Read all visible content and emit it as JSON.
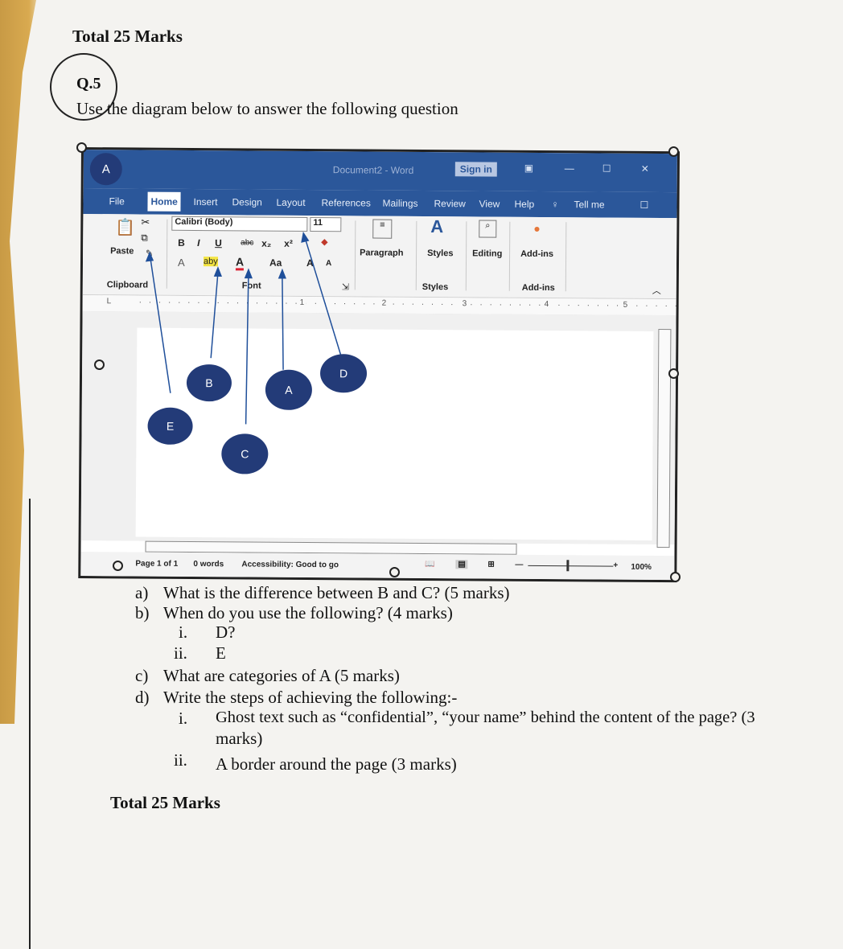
{
  "header": {
    "total_top": "Total 25 Marks"
  },
  "question": {
    "number": "Q.5",
    "instruction": "Use the diagram below to answer the following question"
  },
  "word_ui": {
    "title_button": "A",
    "document_title": "Document2 - Word",
    "sign_in": "Sign in",
    "tabs": [
      "File",
      "Home",
      "Insert",
      "Design",
      "Layout",
      "References",
      "Mailings",
      "Review",
      "View",
      "Help"
    ],
    "tell_me": "Tell me",
    "paste": "Paste",
    "clipboard_group": "Clipboard",
    "font_name": "Calibri (Body)",
    "font_size": "11",
    "font_row": [
      "B",
      "I",
      "U",
      "abc",
      "x₂",
      "x²"
    ],
    "font_row2": [
      "A",
      "aby",
      "A",
      "Aa",
      "A",
      "A"
    ],
    "font_group": "Font",
    "paragraph": "Paragraph",
    "styles": "Styles",
    "styles_group": "Styles",
    "editing": "Editing",
    "addins": "Add-ins",
    "addins_group": "Add-ins",
    "ruler_marks": [
      "1",
      "2",
      "3",
      "4",
      "5"
    ],
    "status_page": "Page 1 of 1",
    "status_words": "0 words",
    "status_accessibility": "Accessibility: Good to go",
    "zoom": "100%",
    "callouts": {
      "b": "B",
      "a": "A",
      "d": "D",
      "e": "E",
      "c": "C"
    }
  },
  "questions": {
    "a": {
      "label": "a)",
      "text": "What is the difference between B and C? (5 marks)"
    },
    "b": {
      "label": "b)",
      "text": "When do you use the following? (4 marks)"
    },
    "b_i": {
      "label": "i.",
      "text": "D?"
    },
    "b_ii": {
      "label": "ii.",
      "text": "E"
    },
    "c": {
      "label": "c)",
      "text": "What are categories of A (5 marks)"
    },
    "d": {
      "label": "d)",
      "text": "Write the steps of achieving the following:-"
    },
    "d_i": {
      "label": "i.",
      "text": "Ghost text such as “confidential”, “your name” behind the content of the page? (3",
      "text2": "marks)"
    },
    "d_ii": {
      "label": "ii.",
      "text": "A border around the page (3 marks)"
    }
  },
  "footer": {
    "total_bottom": "Total 25 Marks"
  },
  "colors": {
    "word_blue": "#2b579a",
    "callout_navy": "#233b78",
    "desk_wood": "#c89a45"
  }
}
